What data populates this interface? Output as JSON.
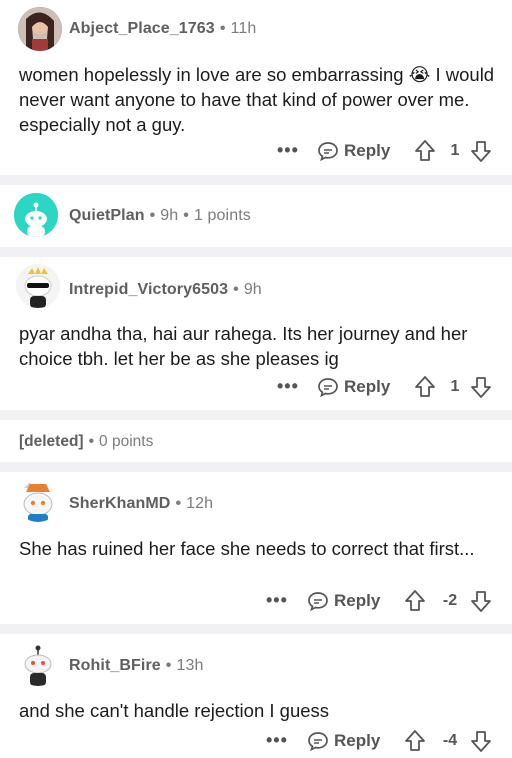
{
  "comments": [
    {
      "username": "Abject_Place_1763",
      "age": "11h",
      "body": "women hopelessly in love are so embarrassing 😭 I would never want anyone to have that kind of power over me. especially not a guy.",
      "reply_label": "Reply",
      "score": "1"
    },
    {
      "username": "QuietPlan",
      "age": "9h",
      "points": "1 points"
    },
    {
      "username": "Intrepid_Victory6503",
      "age": "9h",
      "body": "pyar andha tha, hai aur rahega. Its her journey and her choice tbh. let her be as she pleases ig",
      "reply_label": "Reply",
      "score": "1"
    },
    {
      "username": "[deleted]",
      "points": "0 points"
    },
    {
      "username": "SherKhanMD",
      "age": "12h",
      "body": "She has ruined her face she needs to correct that first...",
      "reply_label": "Reply",
      "score": "-2"
    },
    {
      "username": "Rohit_BFire",
      "age": "13h",
      "body": "and she can't handle rejection I guess",
      "reply_label": "Reply",
      "score": "-4"
    }
  ],
  "dot": "•",
  "more_label": "•••",
  "icons": {
    "reply": "reply-bubble-icon",
    "upvote": "upvote-arrow-icon",
    "downvote": "downvote-arrow-icon",
    "more": "more-dots-icon"
  },
  "colors": {
    "separator": "#f1f1f3",
    "meta": "#7c7c7c",
    "text": "#1c1c1c",
    "avatar_teal": "#2bd6c3"
  }
}
